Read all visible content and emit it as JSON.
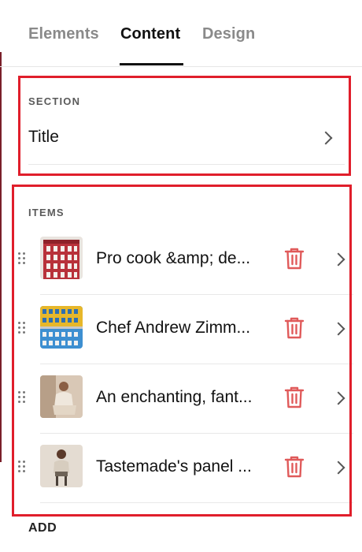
{
  "tabs": [
    {
      "label": "Elements",
      "active": false
    },
    {
      "label": "Content",
      "active": true
    },
    {
      "label": "Design",
      "active": false
    }
  ],
  "section": {
    "heading": "SECTION",
    "title_row": "Title"
  },
  "items": {
    "heading": "ITEMS",
    "list": [
      {
        "title": "Pro cook &amp; de...",
        "thumb": "red-building"
      },
      {
        "title": "Chef Andrew Zimm...",
        "thumb": "yellow-blue-building"
      },
      {
        "title": "An enchanting, fant...",
        "thumb": "seated-person"
      },
      {
        "title": "Tastemade's panel ...",
        "thumb": "person-on-stool"
      }
    ]
  },
  "add_label": "ADD",
  "colors": {
    "accent_red": "#e01e2b",
    "trash_red": "#e05a5a",
    "active_tab": "#111111",
    "inactive_tab": "#8a8a8a"
  }
}
